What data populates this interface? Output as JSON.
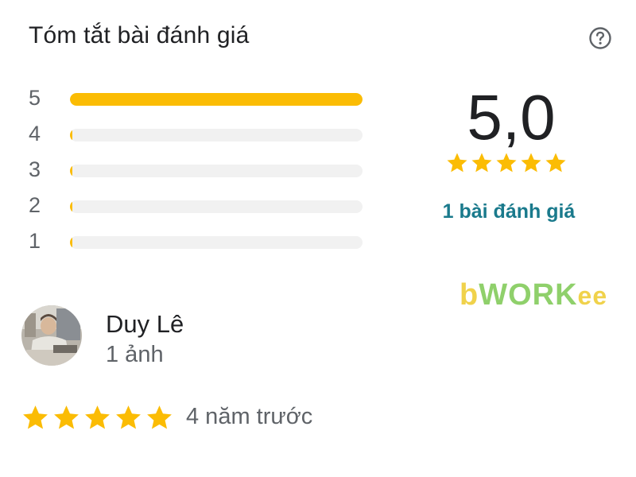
{
  "summary": {
    "title": "Tóm tắt bài đánh giá",
    "help_icon": "help-circle-icon",
    "distribution": [
      {
        "stars": "5",
        "fraction": 1.0
      },
      {
        "stars": "4",
        "fraction": 0.0
      },
      {
        "stars": "3",
        "fraction": 0.0
      },
      {
        "stars": "2",
        "fraction": 0.0
      },
      {
        "stars": "1",
        "fraction": 0.0
      }
    ],
    "average": "5,0",
    "average_stars": 5,
    "review_count_label": "1 bài đánh giá"
  },
  "watermark": {
    "b": "b",
    "work": "WORK",
    "ee": "ee"
  },
  "review": {
    "author": "Duy Lê",
    "photos": "1 ảnh",
    "rating": 5,
    "time": "4 năm trước"
  },
  "colors": {
    "star": "#fbbc04",
    "bar_fill": "#fbbc04",
    "bar_track": "#f1f1f1",
    "link": "#1a7a8c"
  }
}
